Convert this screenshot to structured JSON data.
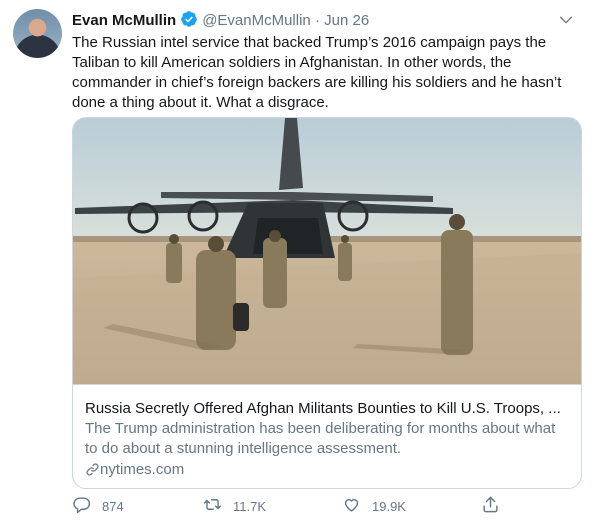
{
  "author": {
    "name": "Evan McMullin",
    "handle": "@EvanMcMullin",
    "separator": "·",
    "date": "Jun 26"
  },
  "tweet": {
    "lines": [
      "The Russian intel service that backed Trump’s 2016 campaign pays the",
      "Taliban to kill American soldiers in Afghanistan. In other words, the",
      "commander in chief’s foreign backers are killing his soldiers and he hasn’t",
      "done a thing about it. What a disgrace."
    ]
  },
  "card": {
    "title": "Russia Secretly Offered Afghan Militants Bounties to Kill U.S. Troops, ...",
    "description_lines": [
      "The Trump administration has been deliberating for months about what",
      "to do about a stunning intelligence assessment."
    ],
    "link": "nytimes.com"
  },
  "actions": {
    "replies": "874",
    "retweets": "11.7K",
    "likes": "19.9K"
  },
  "colors": {
    "text": "#14171a",
    "secondary": "#657786",
    "verified": "#1da1f2",
    "border": "#ccd6dd"
  },
  "icons": [
    "verified-badge-icon",
    "chevron-down-icon",
    "link-icon",
    "reply-icon",
    "retweet-icon",
    "like-icon",
    "share-icon"
  ]
}
